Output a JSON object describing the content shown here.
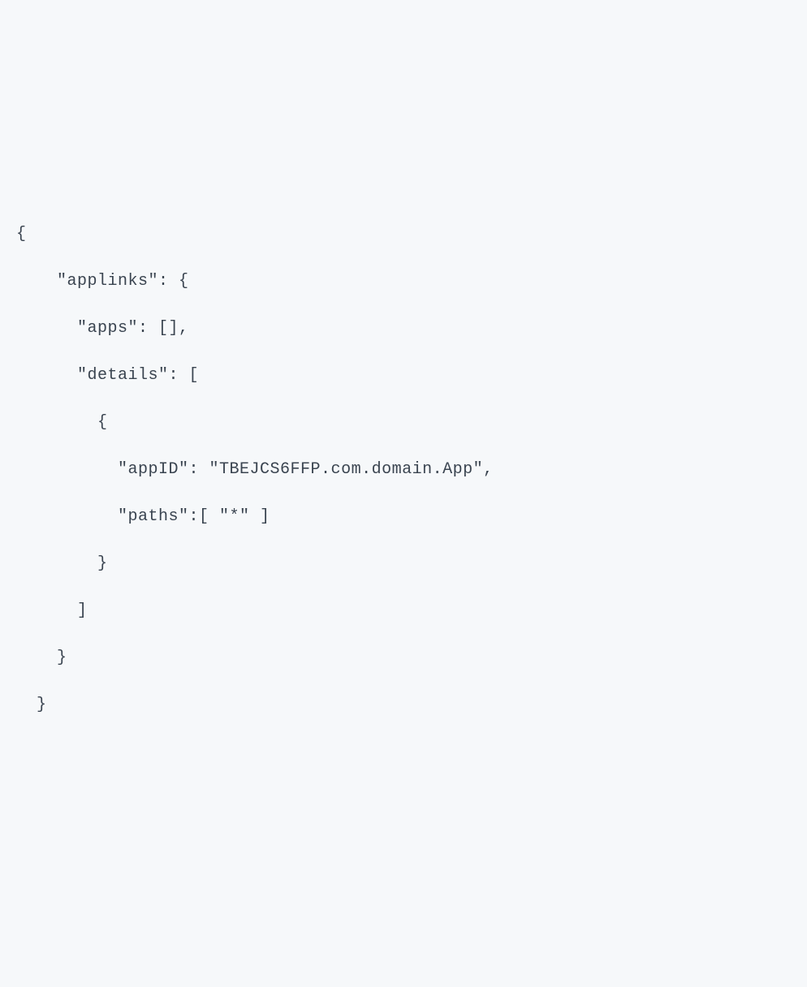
{
  "code": {
    "line1": "{",
    "line2": "    \"applinks\": {",
    "line3": "      \"apps\": [],",
    "line4": "      \"details\": [",
    "line5": "        {",
    "line6": "          \"appID\": \"TBEJCS6FFP.com.domain.App\",",
    "line7": "          \"paths\":[ \"*\" ]",
    "line8": "        }",
    "line9": "      ]",
    "line10": "    }",
    "line11": "  }"
  }
}
